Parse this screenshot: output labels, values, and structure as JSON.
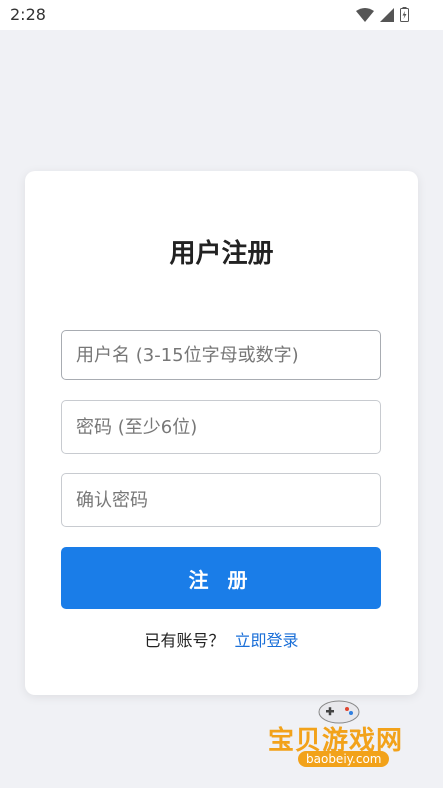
{
  "status_bar": {
    "time": "2:28",
    "icons": [
      "wifi-icon",
      "signal-icon",
      "battery-icon"
    ]
  },
  "form": {
    "title": "用户注册",
    "username_placeholder": "用户名 (3-15位字母或数字)",
    "password_placeholder": "密码 (至少6位)",
    "confirm_placeholder": "确认密码",
    "submit_label": "注 册",
    "has_account_text": "已有账号？",
    "login_link": "立即登录"
  },
  "watermark": {
    "text": "宝贝游戏网",
    "domain": "baobeiy.com"
  },
  "colors": {
    "accent": "#1a7de8",
    "link": "#1a6fd8",
    "background": "#f0f1f5",
    "watermark": "#f2a21a"
  }
}
